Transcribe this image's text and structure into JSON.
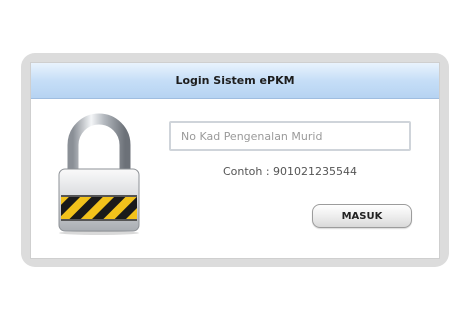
{
  "dialog": {
    "title": "Login Sistem ePKM"
  },
  "form": {
    "id_input": {
      "value": "",
      "placeholder": "No Kad Pengenalan Murid"
    },
    "example_text": "Contoh : 901021235544",
    "submit_label": "MASUK"
  },
  "icons": {
    "lock": "padlock-icon"
  },
  "colors": {
    "titlebar": "#c6def7",
    "frame": "#dcdcdc",
    "lock_stripe_yellow": "#f2c21b",
    "lock_stripe_black": "#1a1a1a"
  }
}
